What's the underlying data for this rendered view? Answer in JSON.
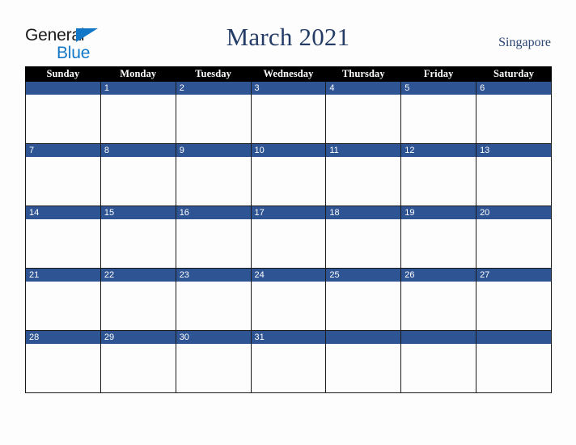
{
  "brand": {
    "line1": "General",
    "line2": "Blue",
    "triangle_color": "#1177c6",
    "line1_color": "#1a1a1a",
    "line2_color": "#1177c6"
  },
  "header": {
    "title": "March 2021",
    "country": "Singapore",
    "title_color": "#243c66",
    "country_color": "#2b4573"
  },
  "calendar": {
    "month": "March",
    "year": "2021",
    "header_background": "#000000",
    "header_text_color": "#ffffff",
    "daynum_band_color": "#2e5494",
    "daynum_text_color": "#ffffff",
    "cell_background": "#fdfdfd",
    "border_color": "#1a1a1a",
    "weekday_headers": [
      "Sunday",
      "Monday",
      "Tuesday",
      "Wednesday",
      "Thursday",
      "Friday",
      "Saturday"
    ],
    "weeks": [
      [
        "",
        "1",
        "2",
        "3",
        "4",
        "5",
        "6"
      ],
      [
        "7",
        "8",
        "9",
        "10",
        "11",
        "12",
        "13"
      ],
      [
        "14",
        "15",
        "16",
        "17",
        "18",
        "19",
        "20"
      ],
      [
        "21",
        "22",
        "23",
        "24",
        "25",
        "26",
        "27"
      ],
      [
        "28",
        "29",
        "30",
        "31",
        "",
        "",
        ""
      ]
    ]
  }
}
